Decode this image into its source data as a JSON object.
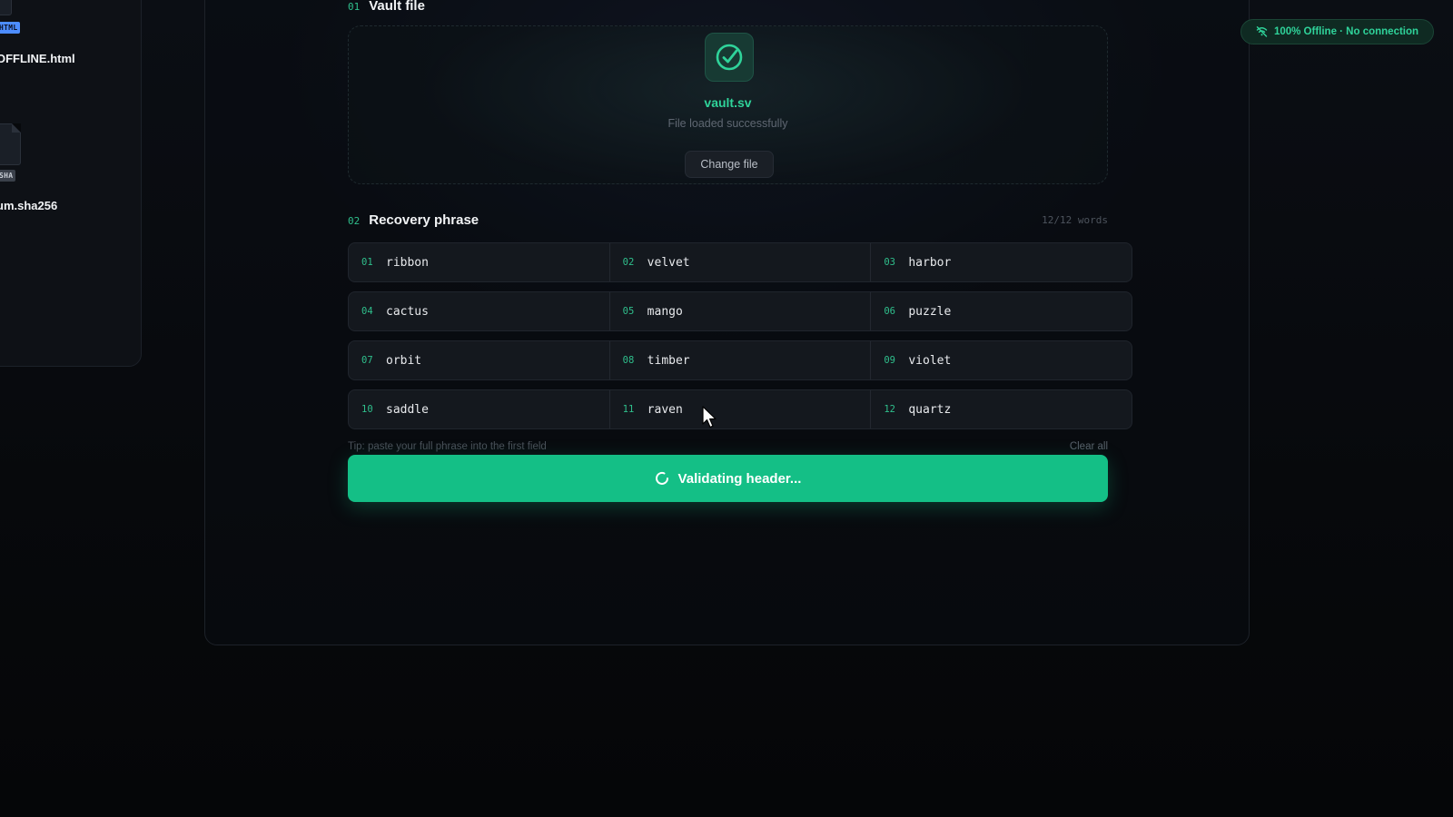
{
  "desktop": {
    "files": [
      {
        "tag": "HTML",
        "name": "OFFLINE.html"
      },
      {
        "tag": "SHA",
        "name": "um.sha256"
      }
    ]
  },
  "vault": {
    "step": "01",
    "title": "Vault file",
    "file_name": "vault.sv",
    "status": "File loaded successfully",
    "change_label": "Change file"
  },
  "recovery": {
    "step": "02",
    "title": "Recovery phrase",
    "count": "12/12 words",
    "rows": [
      [
        {
          "idx": "01",
          "word": "ribbon"
        },
        {
          "idx": "02",
          "word": "velvet"
        },
        {
          "idx": "03",
          "word": "harbor"
        }
      ],
      [
        {
          "idx": "04",
          "word": "cactus"
        },
        {
          "idx": "05",
          "word": "mango"
        },
        {
          "idx": "06",
          "word": "puzzle"
        }
      ],
      [
        {
          "idx": "07",
          "word": "orbit"
        },
        {
          "idx": "08",
          "word": "timber"
        },
        {
          "idx": "09",
          "word": "violet"
        }
      ],
      [
        {
          "idx": "10",
          "word": "saddle"
        },
        {
          "idx": "11",
          "word": "raven"
        },
        {
          "idx": "12",
          "word": "quartz"
        }
      ]
    ],
    "tip": "Tip: paste your full phrase into the first field",
    "clear_label": "Clear all"
  },
  "action": {
    "validate_label": "Validating header..."
  },
  "status_pill": {
    "label": "100% Offline · No connection"
  },
  "colors": {
    "accent": "#14bf86",
    "accent_text": "#2fd39a",
    "background": "#07090c"
  }
}
